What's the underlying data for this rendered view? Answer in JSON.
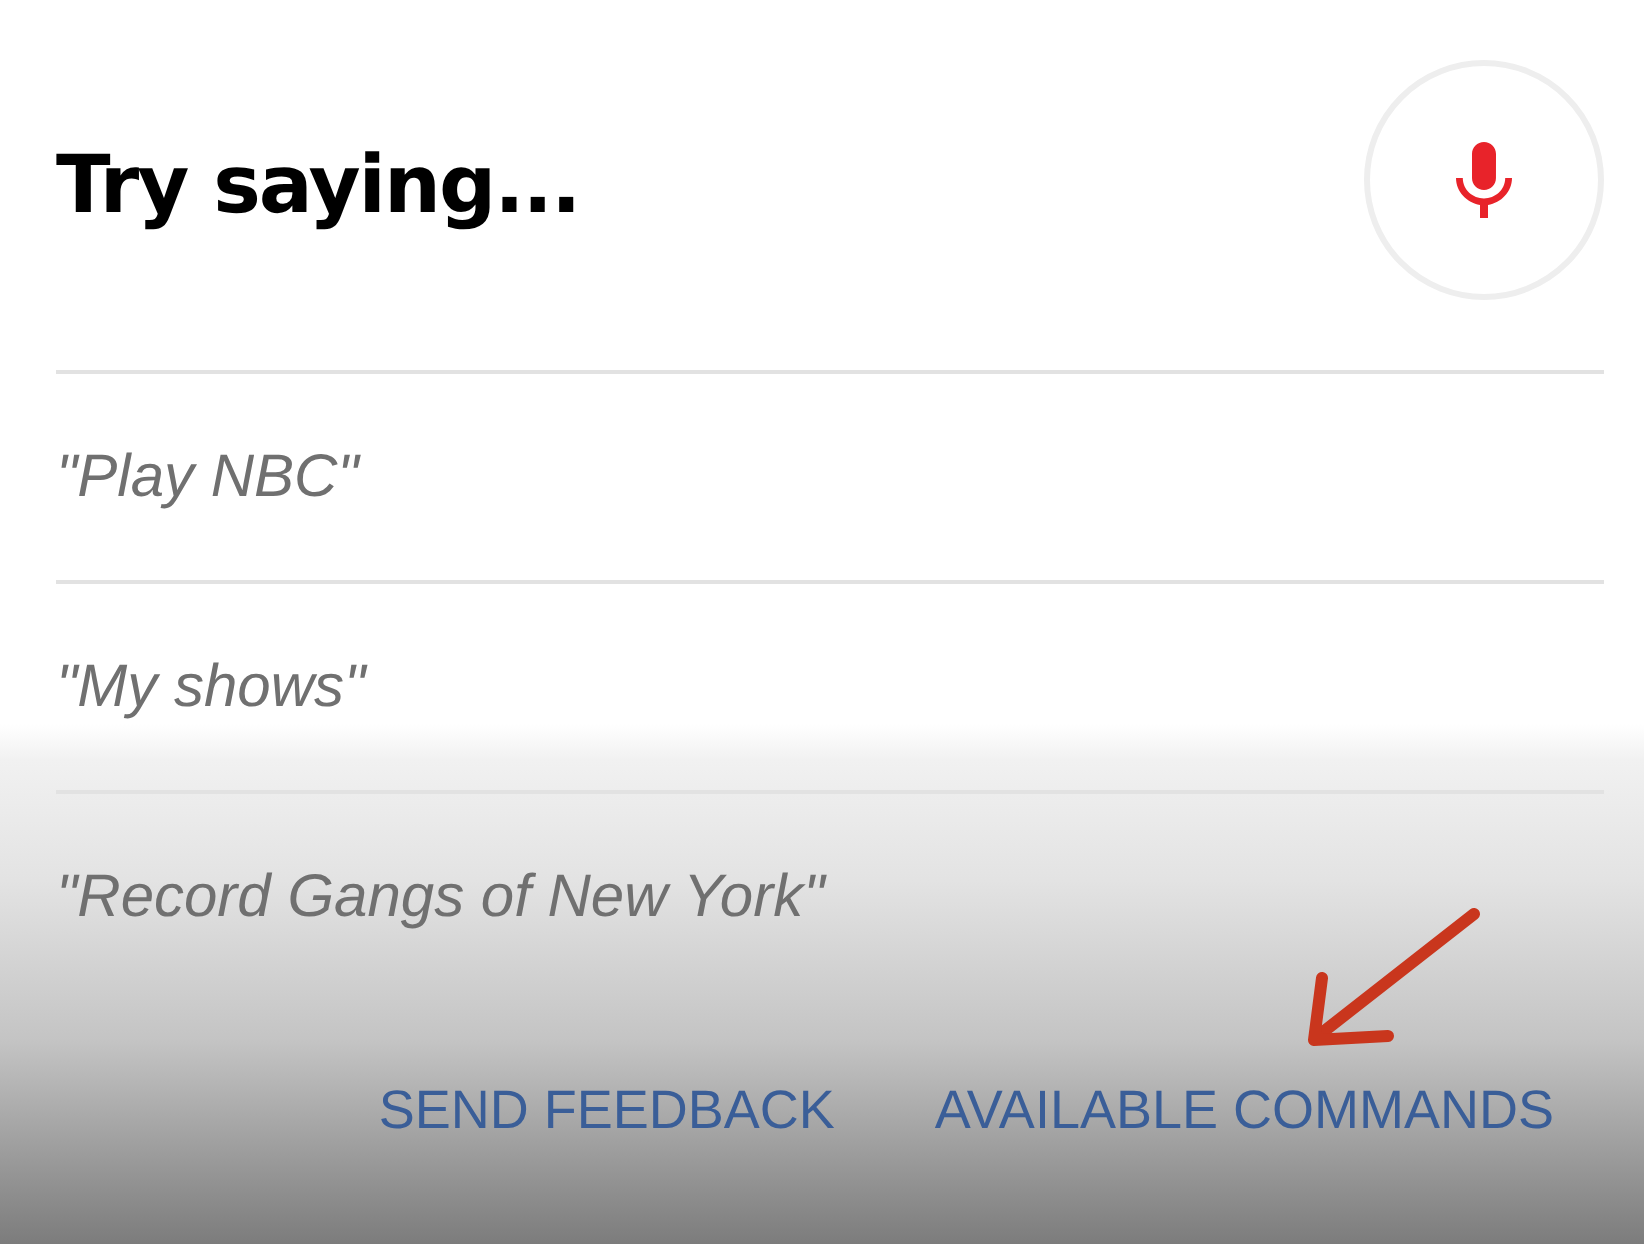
{
  "title": "Try saying...",
  "suggestions": [
    "\"Play NBC\"",
    "\"My shows\"",
    "\"Record Gangs of New York\""
  ],
  "actions": [
    "SEND FEEDBACK",
    "AVAILABLE COMMANDS"
  ],
  "annotations": [
    {
      "kind": "arrow"
    }
  ]
}
